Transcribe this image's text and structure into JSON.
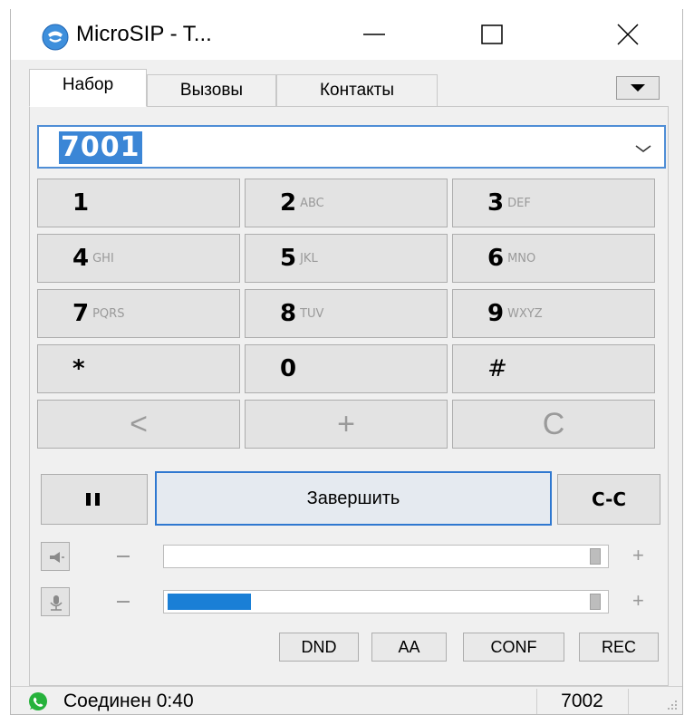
{
  "window": {
    "title": "MicroSIP - T...",
    "accent_color": "#2f78d0"
  },
  "tabs": [
    {
      "label": "Набор",
      "active": true
    },
    {
      "label": "Вызовы",
      "active": false
    },
    {
      "label": "Контакты",
      "active": false
    }
  ],
  "dialer": {
    "number": "7001",
    "keys": [
      {
        "digit": "1",
        "letters": ""
      },
      {
        "digit": "2",
        "letters": "ABC"
      },
      {
        "digit": "3",
        "letters": "DEF"
      },
      {
        "digit": "4",
        "letters": "GHI"
      },
      {
        "digit": "5",
        "letters": "JKL"
      },
      {
        "digit": "6",
        "letters": "MNO"
      },
      {
        "digit": "7",
        "letters": "PQRS"
      },
      {
        "digit": "8",
        "letters": "TUV"
      },
      {
        "digit": "9",
        "letters": "WXYZ"
      },
      {
        "digit": "*",
        "letters": ""
      },
      {
        "digit": "0",
        "letters": ""
      },
      {
        "digit": "#",
        "letters": ""
      }
    ],
    "controls": {
      "backspace": "<",
      "plus": "+",
      "clear": "C"
    }
  },
  "call": {
    "hold_icon": "pause-icon",
    "end_label": "Завершить",
    "transfer_label": "C-C"
  },
  "audio": {
    "speaker_icon": "speaker-icon",
    "microphone_icon": "microphone-icon",
    "speaker_level": 0,
    "microphone_level": 0.2,
    "minus": "−",
    "plus": "+"
  },
  "features": {
    "dnd": "DND",
    "aa": "AA",
    "conf": "CONF",
    "rec": "REC"
  },
  "status": {
    "text": "Соединен 0:40",
    "extension": "7002",
    "icon": "phone-status-icon"
  }
}
